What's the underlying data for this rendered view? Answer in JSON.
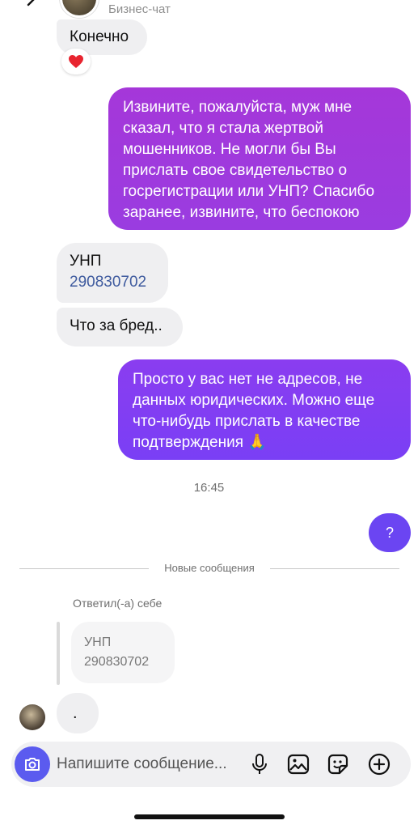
{
  "header": {
    "subtitle": "Бизнес-чат"
  },
  "messages": {
    "m1": {
      "text": "Конечно",
      "reaction": "❤️"
    },
    "m2": {
      "text": "Извините, пожалуйста, муж мне сказал, что я стала жертвой мошенников. Не могли бы Вы прислать свое свидетельство о госрегистрации или УНП? Спасибо заранее, извините, что беспокою"
    },
    "m3": {
      "line1": "УНП",
      "line2": "290830702"
    },
    "m4": {
      "text": "Что за бред.."
    },
    "m5": {
      "text": "Просто у вас нет не адресов, не данных юридических. Можно еще что-нибудь прислать в качестве подтверждения 🙏"
    },
    "time": "16:45",
    "m6": {
      "text": "?"
    },
    "new_divider": "Новые сообщения",
    "replied_label": "Ответил(-а) себе",
    "quote": {
      "line1": "УНП",
      "line2": "290830702"
    },
    "m7": {
      "text": "."
    }
  },
  "composer": {
    "placeholder": "Напишите сообщение..."
  },
  "icons": {
    "back": "chevron-left-icon",
    "camera": "camera-icon",
    "mic": "microphone-icon",
    "gallery": "image-icon",
    "sticker": "sticker-icon",
    "plus": "plus-circle-icon"
  },
  "colors": {
    "outgoing_1": "#a537d9",
    "outgoing_2": "#8a3df0",
    "outgoing_3": "#6b45f2",
    "incoming": "#efeff1",
    "camera_button": "#5b5bef"
  }
}
